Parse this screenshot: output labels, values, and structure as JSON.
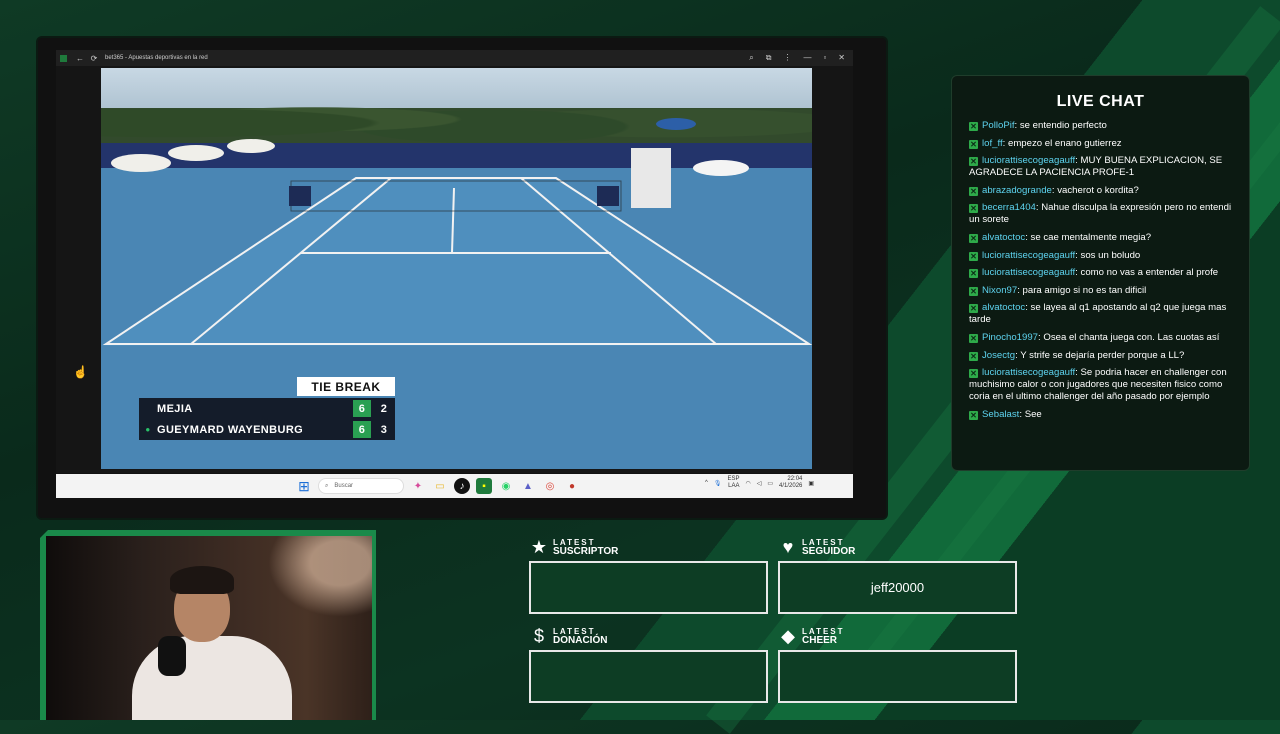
{
  "browser": {
    "tab_title": "bet365 - Apuestas deportivas en la red"
  },
  "scoreboard": {
    "banner": "TIE BREAK",
    "players": [
      {
        "name": "MEJIA",
        "set": "6",
        "points": "2",
        "serving": false
      },
      {
        "name": "GUEYMARD WAYENBURG",
        "set": "6",
        "points": "3",
        "serving": true
      }
    ]
  },
  "taskbar": {
    "search_placeholder": "Buscar",
    "lang_top": "ESP",
    "lang_bottom": "LAA",
    "time": "22:04",
    "date": "4/1/2026"
  },
  "chat": {
    "title": "LIVE CHAT",
    "messages": [
      {
        "user": "PolloPif",
        "text": "se entendio perfecto"
      },
      {
        "user": "lof_ff",
        "text": "empezo el enano gutierrez"
      },
      {
        "user": "luciorattisecogeagauff",
        "text": "MUY BUENA EXPLICACION, SE AGRADECE LA PACIENCIA PROFE-1"
      },
      {
        "user": "abrazadogrande",
        "text": "vacherot o kordita?"
      },
      {
        "user": "becerra1404",
        "text": "Nahue disculpa la expresión pero no entendi un sorete"
      },
      {
        "user": "alvatoctoc",
        "text": "se cae mentalmente megia?"
      },
      {
        "user": "luciorattisecogeagauff",
        "text": "sos un boludo"
      },
      {
        "user": "luciorattisecogeagauff",
        "text": "como no vas a entender al profe"
      },
      {
        "user": "Nixon97",
        "text": "para amigo si no es tan dificil"
      },
      {
        "user": "alvatoctoc",
        "text": "se layea al q1 apostando al q2 que juega mas tarde"
      },
      {
        "user": "Pinocho1997",
        "text": "Osea el chanta juega con. Las cuotas así"
      },
      {
        "user": "Josectg",
        "text": "Y strife se dejaría perder porque a LL?"
      },
      {
        "user": "luciorattisecogeagauff",
        "text": "Se podria hacer en challenger con muchisimo calor o con jugadores que necesiten fisico como coria en el ultimo challenger del año pasado por ejemplo"
      },
      {
        "user": "Sebalast",
        "text": "See"
      }
    ]
  },
  "widgets": {
    "suscriptor": {
      "label_top": "LATEST",
      "label_bottom": "SUSCRIPTOR",
      "icon": "star-icon",
      "value": ""
    },
    "seguidor": {
      "label_top": "LATEST",
      "label_bottom": "SEGUIDOR",
      "icon": "heart-icon",
      "value": "jeff20000"
    },
    "donacion": {
      "label_top": "LATEST",
      "label_bottom": "DONACIÓN",
      "icon": "dollar-icon",
      "value": ""
    },
    "cheer": {
      "label_top": "LATEST",
      "label_bottom": "CHEER",
      "icon": "diamond-icon",
      "value": ""
    }
  },
  "colors": {
    "accent_green": "#2aa052",
    "chat_username": "#5ed4f0",
    "background": "#0f3a25"
  }
}
